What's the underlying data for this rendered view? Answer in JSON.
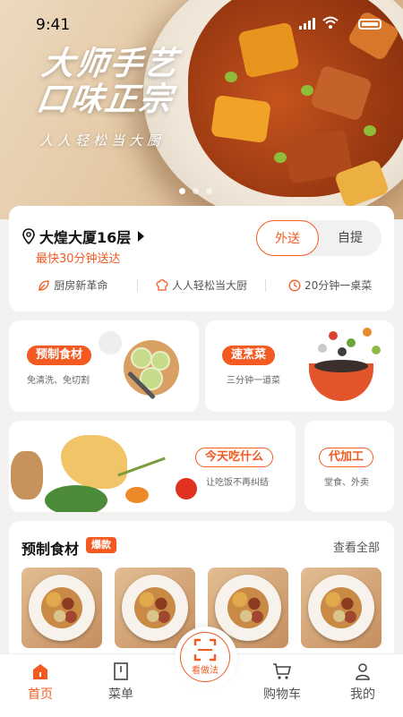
{
  "status_bar": {
    "time": "9:41"
  },
  "banner": {
    "title_line1": "大师手艺",
    "title_line2": "口味正宗",
    "subtitle": "人人轻松当大厨",
    "slides": 3,
    "active_slide": 1
  },
  "location": {
    "address": "大煌大厦16层",
    "eta": "最快30分钟送达",
    "mode_delivery": "外送",
    "mode_pickup": "自提",
    "selected_mode": "外送"
  },
  "features": [
    {
      "label": "厨房新革命",
      "icon": "leaf-icon"
    },
    {
      "label": "人人轻松当大厨",
      "icon": "chef-hat-icon"
    },
    {
      "label": "20分钟一桌菜",
      "icon": "clock-icon"
    }
  ],
  "categories": {
    "prepared": {
      "title": "预制食材",
      "desc": "免清洗、免切割"
    },
    "quick": {
      "title": "速烹菜",
      "desc": "三分钟一道菜"
    },
    "today": {
      "title": "今天吃什么",
      "desc": "让吃饭不再纠结"
    },
    "processing": {
      "title": "代加工",
      "desc": "堂食、外卖"
    }
  },
  "product_section": {
    "title": "预制食材",
    "badge": "爆款",
    "view_all": "查看全部",
    "items": 4
  },
  "nav": {
    "home": "首页",
    "menu": "菜单",
    "center": "看做法",
    "cart": "购物车",
    "mine": "我的",
    "active": "首页"
  },
  "colors": {
    "accent": "#f25a22",
    "background": "#f3f2f1"
  }
}
